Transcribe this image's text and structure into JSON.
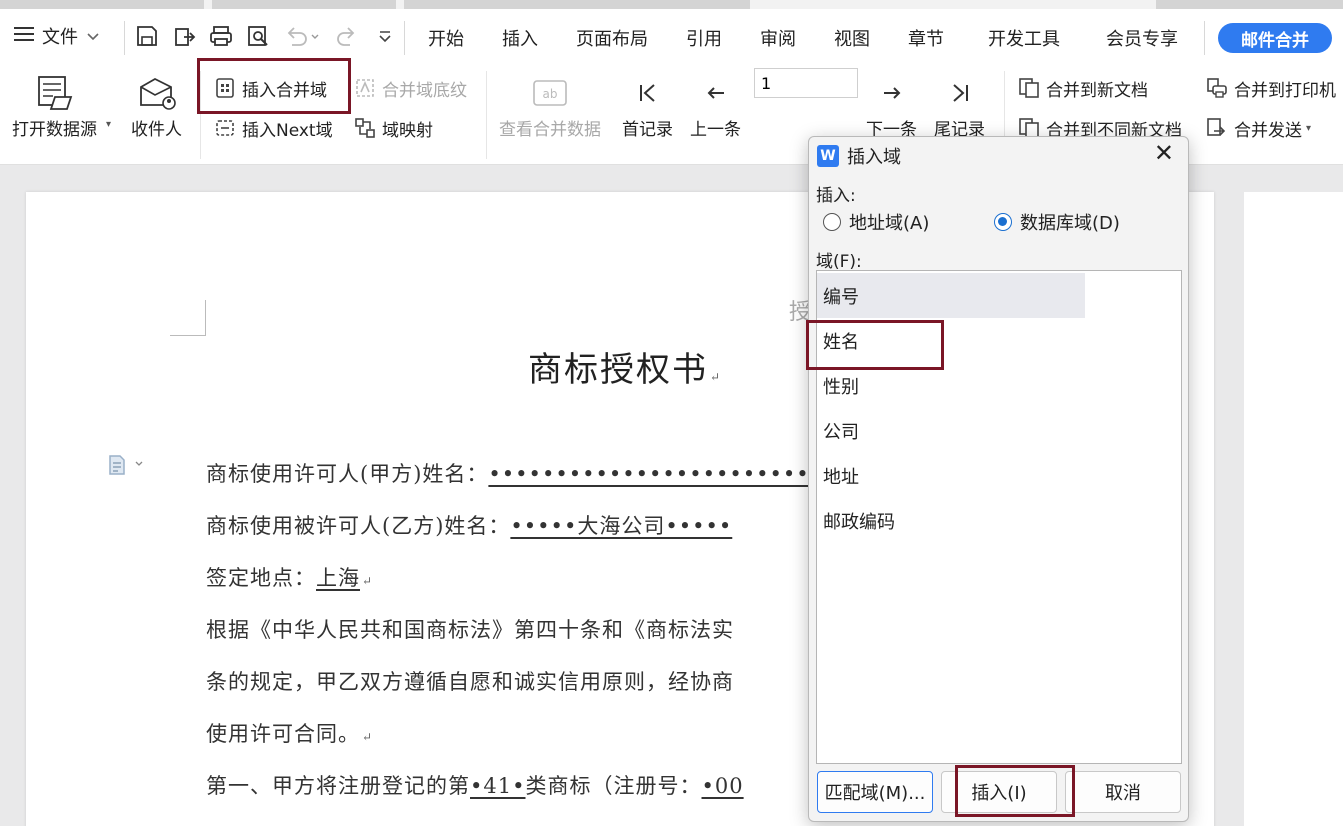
{
  "menu": {
    "file": "文件",
    "tabs": [
      "开始",
      "插入",
      "页面布局",
      "引用",
      "审阅",
      "视图",
      "章节",
      "开发工具",
      "会员专享"
    ],
    "mail_merge": "邮件合并",
    "accent": "#2f7bf0"
  },
  "ribbon": {
    "open_datasource": "打开数据源",
    "recipients": "收件人",
    "insert_merge_field": "插入合并域",
    "merge_field_shading": "合并域底纹",
    "insert_next_field": "插入Next域",
    "field_mapping": "域映射",
    "view_merged_data": "查看合并数据",
    "first_record": "首记录",
    "prev_record": "上一条",
    "record_number": "1",
    "next_record": "下一条",
    "last_record": "尾记录",
    "merge_to_new_doc": "合并到新文档",
    "merge_to_different_docs": "合并到不同新文档",
    "merge_to_printer": "合并到打印机",
    "merge_send": "合并发送"
  },
  "document": {
    "header_fragment": "授",
    "title": "商标授权书",
    "para_mark": "↵",
    "lines": [
      {
        "prefix": "商标使用许可人(甲方)姓名：",
        "field": "••••••••••••••••••••••••"
      },
      {
        "prefix": "商标使用被许可人(乙方)姓名：",
        "field": "•••••大海公司•••••"
      },
      {
        "prefix": "签定地点：",
        "field": "上海"
      },
      {
        "prefix": "根据《中华人民共和国商标法》第四十条和《商标法实",
        "field": ""
      },
      {
        "prefix": "条的规定，甲乙双方遵循自愿和诚实信用原则，经协商",
        "field": ""
      },
      {
        "prefix": "使用许可合同。",
        "field": ""
      },
      {
        "prefix": "第一、甲方将注册登记的第",
        "field": "•41•",
        "suffix": "类商标（注册号：",
        "field2": "•00"
      }
    ]
  },
  "dialog": {
    "title": "插入域",
    "insert_label": "插入:",
    "radio_address": "地址域(A)",
    "radio_database": "数据库域(D)",
    "fields_label": "域(F):",
    "fields": [
      "编号",
      "姓名",
      "性别",
      "公司",
      "地址",
      "邮政编码"
    ],
    "match_fields": "匹配域(M)...",
    "insert": "插入(I)",
    "cancel": "取消"
  }
}
